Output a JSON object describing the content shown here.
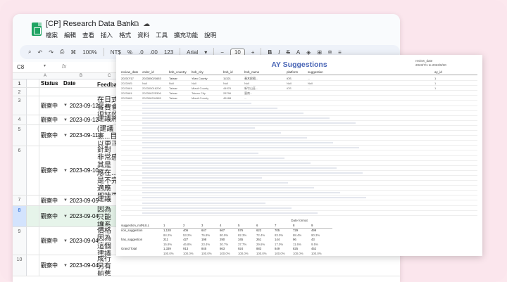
{
  "sheets": {
    "doc_title": "[CP] Research Data Bank",
    "title_icons": [
      "star-icon",
      "move-to-folder-icon",
      "cloud-status-icon"
    ],
    "menu": [
      "檔案",
      "編輯",
      "查看",
      "插入",
      "格式",
      "資料",
      "工具",
      "擴充功能",
      "說明"
    ],
    "toolbar": {
      "zoom": "100%",
      "currency": "NT$",
      "percent": "%",
      "dec1": ".0",
      "dec2": ".00",
      "num_format": "123",
      "font": "Arial",
      "font_size": "10",
      "minus": "−",
      "plus": "+"
    },
    "name_box": "C8",
    "fx": "fx",
    "column_headers": [
      "A",
      "B",
      "C",
      "D"
    ],
    "header_row": {
      "status": "Status",
      "date": "Date",
      "feedback": "Feedba"
    },
    "rows": [
      {
        "num": "1",
        "status": "Status",
        "date": "Date",
        "feedback": "Feedba",
        "header": true
      },
      {
        "num": "2",
        "status": "",
        "date": "",
        "feedback": ""
      },
      {
        "num": "3",
        "status": "觀察中",
        "date": "2023-09-12",
        "feedback": "在日式\n餐費會\n很好的"
      },
      {
        "num": "4",
        "status": "觀察中",
        "date": "2023-09-12",
        "feedback": "建議將"
      },
      {
        "num": "5",
        "status": "觀察中",
        "date": "2023-09-11",
        "feedback": "(建議\n憲...目\n以更正"
      },
      {
        "num": "6",
        "status": "觀察中",
        "date": "2023-09-10",
        "feedback": "針對\n非常感\n其是\n應在...\n是不完\n適應\n即時更"
      },
      {
        "num": "7",
        "status": "觀察中",
        "date": "2023-09-05",
        "feedback": "建議\n"
      },
      {
        "num": "8",
        "status": "觀察中",
        "date": "2023-09-04",
        "feedback": "因為\n只能\n讓系"
      },
      {
        "num": "9",
        "status": "觀察中",
        "date": "2023-09-04",
        "feedback": "價格\n因為\n這個\n建議"
      },
      {
        "num": "10",
        "status": "觀察中",
        "date": "2023-09-04",
        "feedback": "成行\n另有\n船舊"
      }
    ]
  },
  "report": {
    "title": "AY Suggestions",
    "review_date_label": "review_date",
    "review_date_value": "2023/7/1 to 2023/9/30",
    "columns": [
      "review_date",
      "order_id",
      "bnb_country",
      "bnb_city",
      "bnb_id",
      "bnb_name",
      "platform",
      "suggestion",
      "",
      "ay_id"
    ],
    "rows": [
      {
        "date": "2023/7/17",
        "order": "202305021653",
        "country": "Taiwan",
        "city": "Yilan County",
        "bnb": "11321",
        "name": "青木民宿...",
        "platform": "iOS",
        "suggestion": "...",
        "n": "1",
        "grp": true
      },
      {
        "date": "2023/9/5",
        "order": "Null",
        "country": "Null",
        "city": "Null",
        "bnb": "Null",
        "name": "Null",
        "platform": "Null",
        "suggestion": "Null",
        "n": "1"
      },
      {
        "date": "2023/8/4",
        "order": "202305016200",
        "country": "Taiwan",
        "city": "Miaoli County",
        "bnb": "44976",
        "name": "新竹山莊...",
        "platform": "iOS",
        "suggestion": "...",
        "n": "1"
      },
      {
        "date": "2023/8/4",
        "order": "202306225306",
        "country": "Taiwan",
        "city": "Tainan City",
        "bnb": "28796",
        "name": "臺南..."
      },
      {
        "date": "2023/8/6",
        "order": "202306294585",
        "country": "Taiwan",
        "city": "Miaoli County",
        "bnb": "45188",
        "name": "..."
      }
    ],
    "summary_title": "Date format",
    "summary": {
      "cols": [
        "suggestion_notNULL",
        "1",
        "2",
        "3",
        "4",
        "5",
        "6",
        "7",
        "8",
        "9"
      ],
      "rows": [
        {
          "label": "non_suggestion",
          "vals": [
            "1,128",
            "406",
            "647",
            "667",
            "576",
            "622",
            "705",
            "729",
            "499"
          ]
        },
        {
          "label": "",
          "sub": true,
          "vals": [
            "84.2%",
            "53.2%",
            "76.8%",
            "80.9%",
            "82.3%",
            "72.4%",
            "83.0%",
            "88.4%",
            "90.3%"
          ]
        },
        {
          "label": "has_suggestion",
          "vals": [
            "211",
            "427",
            "198",
            "290",
            "345",
            "261",
            "144",
            "96",
            "43"
          ]
        },
        {
          "label": "",
          "sub": true,
          "vals": [
            "15.8%",
            "46.8%",
            "23.4%",
            "30.7%",
            "37.7%",
            "29.6%",
            "17.0%",
            "11.6%",
            "9.5%"
          ]
        },
        {
          "label": "Grand Total",
          "vals": [
            "1,339",
            "913",
            "845",
            "863",
            "924",
            "883",
            "849",
            "825",
            "452"
          ]
        },
        {
          "label": "",
          "sub": true,
          "vals": [
            "100.0%",
            "100.0%",
            "100.0%",
            "100.0%",
            "100.0%",
            "100.0%",
            "100.0%",
            "100.0%",
            "100.0%"
          ]
        }
      ]
    }
  }
}
